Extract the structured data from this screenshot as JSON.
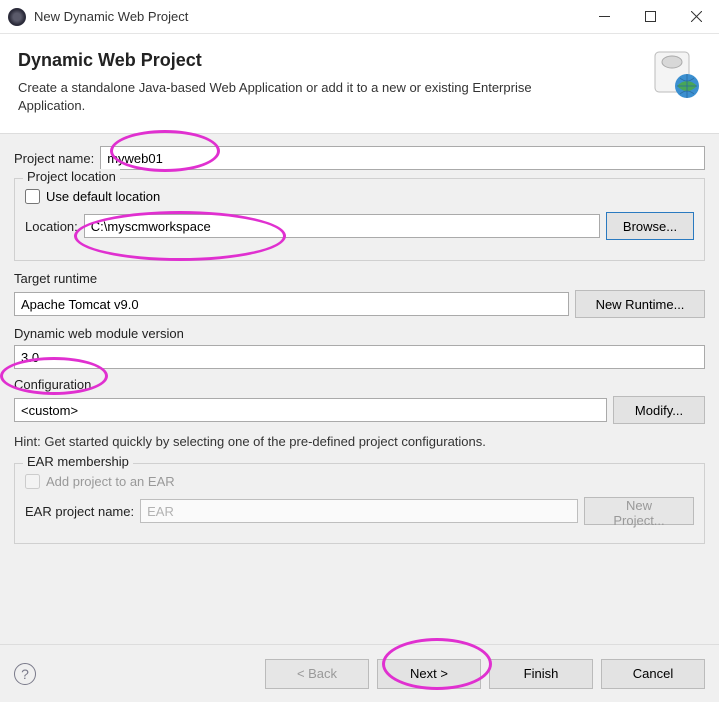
{
  "window": {
    "title": "New Dynamic Web Project"
  },
  "header": {
    "title": "Dynamic Web Project",
    "description": "Create a standalone Java-based Web Application or add it to a new or existing Enterprise Application."
  },
  "project_name": {
    "label": "Project name:",
    "value": "myweb01"
  },
  "project_location": {
    "group_label": "Project location",
    "use_default_label": "Use default location",
    "use_default_checked": false,
    "location_label": "Location:",
    "location_value": "C:\\myscmworkspace",
    "browse_label": "Browse..."
  },
  "target_runtime": {
    "label": "Target runtime",
    "value": "Apache Tomcat v9.0",
    "new_runtime_label": "New Runtime..."
  },
  "web_module_version": {
    "label": "Dynamic web module version",
    "value": "3.0"
  },
  "configuration": {
    "label": "Configuration",
    "value": "<custom>",
    "modify_label": "Modify...",
    "hint": "Hint: Get started quickly by selecting one of the pre-defined project configurations."
  },
  "ear": {
    "group_label": "EAR membership",
    "add_label": "Add project to an EAR",
    "add_checked": false,
    "project_name_label": "EAR project name:",
    "project_name_value": "EAR",
    "new_project_label": "New Project..."
  },
  "footer": {
    "back": "< Back",
    "next": "Next >",
    "finish": "Finish",
    "cancel": "Cancel"
  }
}
